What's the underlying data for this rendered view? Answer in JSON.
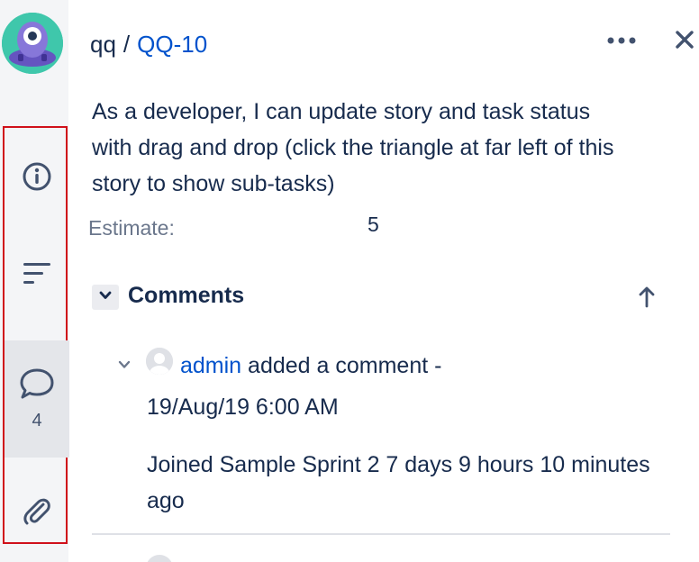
{
  "breadcrumb": {
    "project": "qq",
    "separator": "/",
    "issue_key": "QQ-10"
  },
  "summary": "As a developer, I can update story and task status with drag and drop (click the triangle at far left of this story to show sub-tasks)",
  "estimate": {
    "label": "Estimate:",
    "value": "5"
  },
  "comments": {
    "title": "Comments",
    "items": [
      {
        "author": "admin",
        "action": "added a comment -",
        "date": "19/Aug/19 6:00 AM",
        "body": "Joined Sample Sprint 2 7 days 9 hours 10 minutes ago"
      }
    ]
  },
  "rail": {
    "comment_count": "4"
  },
  "icons": {
    "avatar": "project-avatar-icon",
    "details": "info-icon",
    "description": "text-lines-icon",
    "comments": "speech-bubble-icon",
    "attachments": "paperclip-icon",
    "more": "more-dots-icon",
    "close": "close-icon",
    "sort": "arrow-up-icon",
    "collapse": "chevron-down-icon"
  },
  "colors": {
    "link": "#0052cc",
    "highlight_border": "#d0101a",
    "rail_bg": "#f4f5f7",
    "text": "#172b4d",
    "muted": "#6b778c"
  }
}
